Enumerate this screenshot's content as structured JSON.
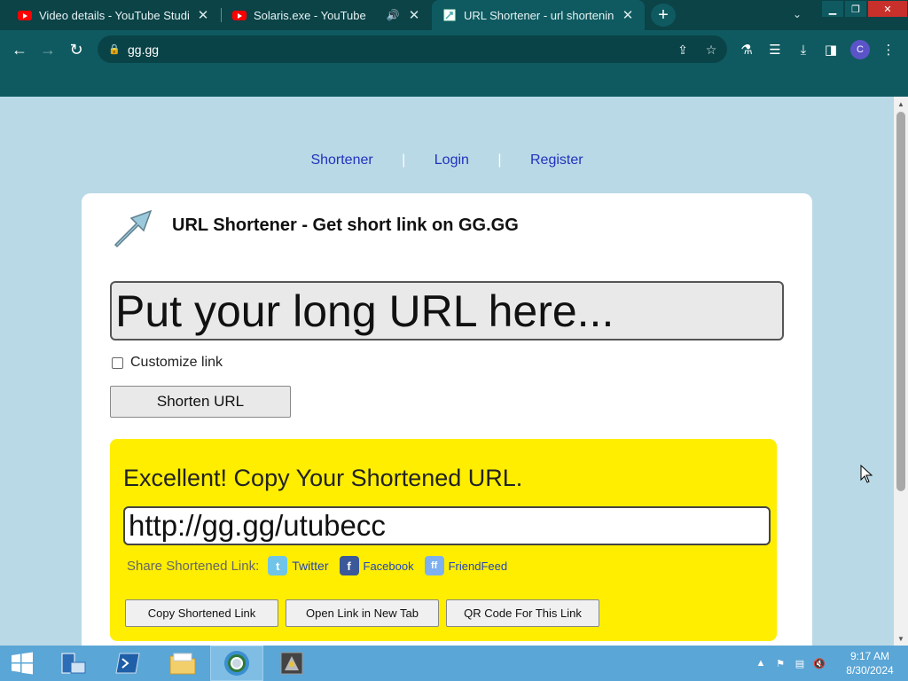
{
  "browser": {
    "tabs": [
      {
        "title": "Video details - YouTube Studio",
        "icon": "youtube-icon"
      },
      {
        "title": "Solaris.exe - YouTube",
        "icon": "youtube-icon"
      },
      {
        "title": "URL Shortener - url shortening s",
        "icon": "site-favicon"
      }
    ],
    "url": "gg.gg"
  },
  "page": {
    "nav": {
      "shortener": "Shortener",
      "login": "Login",
      "register": "Register",
      "sep": "|"
    },
    "title": "URL Shortener - Get short link on GG.GG",
    "input_placeholder": "Put your long URL here...",
    "customize_label": "Customize link",
    "shorten_button": "Shorten URL",
    "result": {
      "title": "Excellent! Copy Your Shortened URL.",
      "short_url": "http://gg.gg/utubecc",
      "share_label": "Share Shortened Link:",
      "share": {
        "twitter": "Twitter",
        "facebook": "Facebook",
        "friendfeed": "FriendFeed"
      },
      "buttons": {
        "copy": "Copy Shortened Link",
        "open": "Open Link in New Tab",
        "qr": "QR Code For This Link"
      }
    }
  },
  "avatar_letter": "C",
  "taskbar": {
    "time": "9:17 AM",
    "date": "8/30/2024"
  },
  "colors": {
    "accent": "#0e5a60",
    "page_bg": "#b9d9e6",
    "result_bg": "#ffee00",
    "link": "#2233bb"
  }
}
